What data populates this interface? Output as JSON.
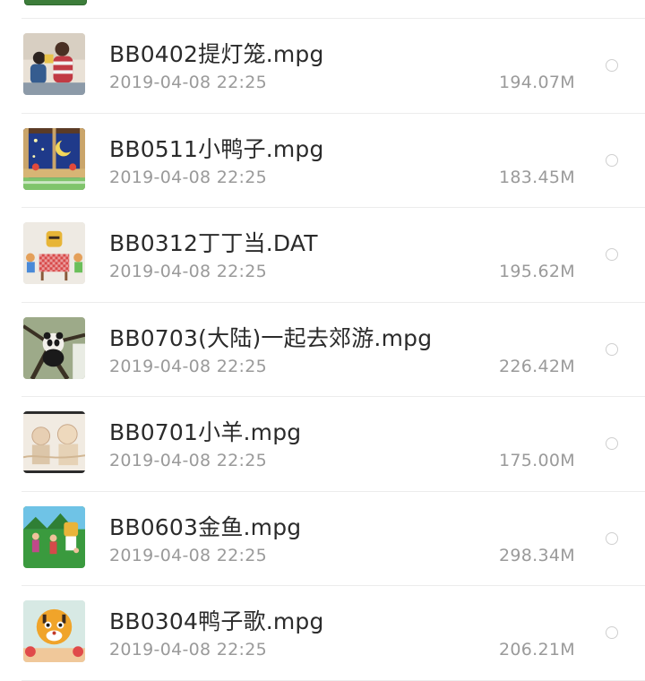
{
  "files": [
    {
      "name": "BB0402提灯笼.mpg",
      "date": "2019-04-08 22:25",
      "size": "194.07M",
      "thumb_icon": "video-thumbnail-mother-child"
    },
    {
      "name": "BB0511小鸭子.mpg",
      "date": "2019-04-08 22:25",
      "size": "183.45M",
      "thumb_icon": "video-thumbnail-night-window"
    },
    {
      "name": "BB0312丁丁当.DAT",
      "date": "2019-04-08 22:25",
      "size": "195.62M",
      "thumb_icon": "video-thumbnail-tiger-table"
    },
    {
      "name": "BB0703(大陆)一起去郊游.mpg",
      "date": "2019-04-08 22:25",
      "size": "226.42M",
      "thumb_icon": "video-thumbnail-panda-tree"
    },
    {
      "name": "BB0701小羊.mpg",
      "date": "2019-04-08 22:25",
      "size": "175.00M",
      "thumb_icon": "video-thumbnail-cartoon-sketch"
    },
    {
      "name": "BB0603金鱼.mpg",
      "date": "2019-04-08 22:25",
      "size": "298.34M",
      "thumb_icon": "video-thumbnail-kids-dancing"
    },
    {
      "name": "BB0304鸭子歌.mpg",
      "date": "2019-04-08 22:25",
      "size": "206.21M",
      "thumb_icon": "video-thumbnail-tiger-mascot"
    }
  ],
  "colors": {
    "title_text": "#2b2b2b",
    "meta_text": "#9a9a9a",
    "divider": "#ececec",
    "radio_border": "#cfcfcf"
  }
}
